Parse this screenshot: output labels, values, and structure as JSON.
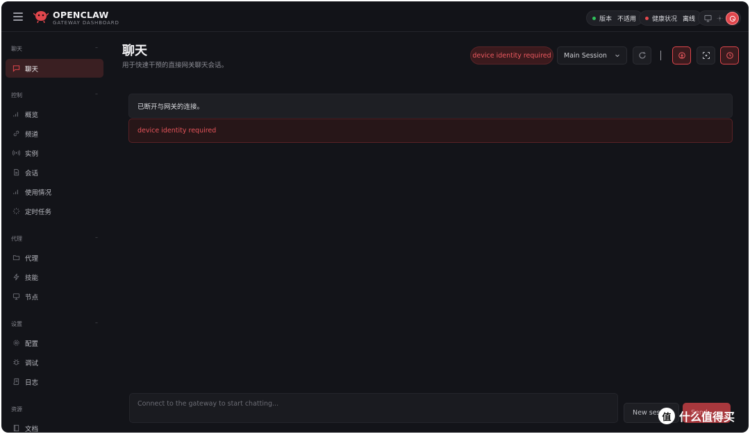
{
  "app": {
    "brand_name": "OPENCLAW",
    "brand_subtitle": "GATEWAY DASHBOARD"
  },
  "header": {
    "version_label": "版本",
    "version_value": "不适用",
    "health_label": "健康状况",
    "health_value": "离线",
    "colors": {
      "ok": "#2fc25b",
      "error": "#e5484d",
      "accent": "#e0464c"
    }
  },
  "sidebar": {
    "groups": [
      {
        "title": "聊天",
        "items": [
          {
            "label": "聊天",
            "icon": "message-square-icon",
            "active": true
          }
        ]
      },
      {
        "title": "控制",
        "items": [
          {
            "label": "概览",
            "icon": "bar-chart-icon"
          },
          {
            "label": "频道",
            "icon": "link-icon"
          },
          {
            "label": "实例",
            "icon": "radio-icon"
          },
          {
            "label": "会话",
            "icon": "file-text-icon"
          },
          {
            "label": "使用情况",
            "icon": "bar-chart-icon"
          },
          {
            "label": "定时任务",
            "icon": "loader-icon"
          }
        ]
      },
      {
        "title": "代理",
        "items": [
          {
            "label": "代理",
            "icon": "folder-icon"
          },
          {
            "label": "技能",
            "icon": "zap-icon"
          },
          {
            "label": "节点",
            "icon": "monitor-icon"
          }
        ]
      },
      {
        "title": "设置",
        "items": [
          {
            "label": "配置",
            "icon": "settings-icon"
          },
          {
            "label": "调试",
            "icon": "bug-icon"
          },
          {
            "label": "日志",
            "icon": "scroll-icon"
          }
        ]
      },
      {
        "title": "资源",
        "items": [
          {
            "label": "文档",
            "icon": "book-icon"
          }
        ]
      }
    ]
  },
  "main": {
    "title": "聊天",
    "subtitle": "用于快速干预的直接网关聊天会话。",
    "alert_pill": "device identity required",
    "session_select": "Main Session",
    "status_message": "已断开与网关的连接。",
    "error_message": "device identity required",
    "composer_placeholder": "Connect to the gateway to start chatting...",
    "new_session_label": "New session",
    "send_label": "Send"
  },
  "watermark": {
    "text": "什么值得买",
    "logo": "值"
  }
}
